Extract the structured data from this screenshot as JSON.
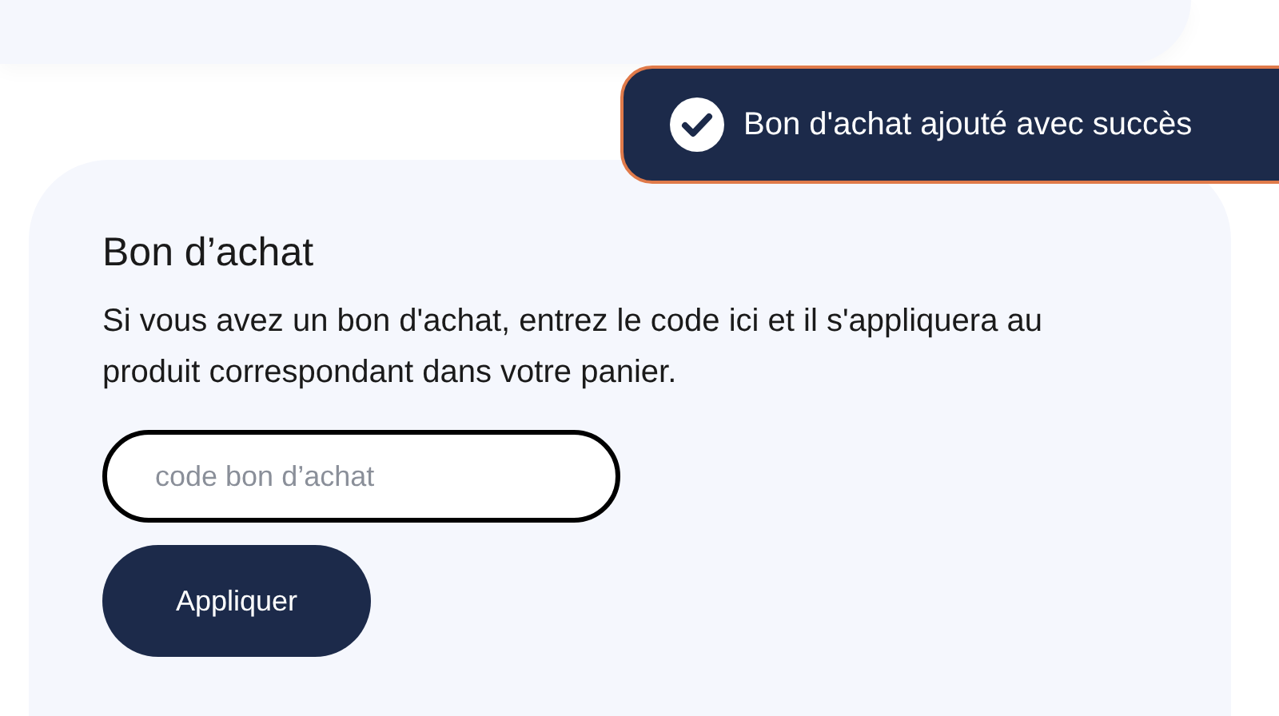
{
  "toast": {
    "message": "Bon d'achat ajouté avec succès"
  },
  "voucher": {
    "title": "Bon d’achat",
    "description": "Si vous avez un bon d'achat, entrez le code ici et il s'appliquera au produit correspondant dans votre panier.",
    "input": {
      "placeholder": "code bon d’achat"
    },
    "button": "Appliquer"
  }
}
